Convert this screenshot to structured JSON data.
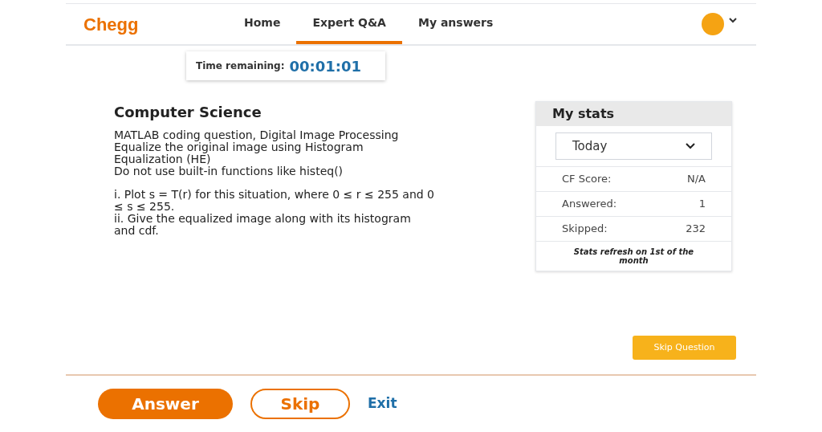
{
  "header": {
    "logo": "Chegg",
    "nav": [
      {
        "label": "Home",
        "selected": false
      },
      {
        "label": "Expert Q&A",
        "selected": true
      },
      {
        "label": "My answers",
        "selected": false
      }
    ]
  },
  "timer": {
    "label": "Time remaining:",
    "value": "00:01:01"
  },
  "question": {
    "subject": "Computer Science",
    "paragraphs": [
      [
        "MATLAB coding question, Digital Image Processing",
        "Equalize the original image using Histogram",
        "Equalization (HE)",
        "Do not use built-in functions like histeq()"
      ],
      [
        "i. Plot s = T(r) for this situation, where 0 ≤ r ≤ 255 and 0",
        "≤ s ≤ 255.",
        "ii. Give the equalized image along with its histogram",
        "and cdf."
      ]
    ]
  },
  "stats": {
    "title": "My stats",
    "period": "Today",
    "rows": [
      {
        "label": "CF Score:",
        "value": "N/A"
      },
      {
        "label": "Answered:",
        "value": "1"
      },
      {
        "label": "Skipped:",
        "value": "232"
      }
    ],
    "note": "Stats refresh on 1st of the month"
  },
  "skip_question": "Skip Question",
  "footer": {
    "answer": "Answer",
    "skip": "Skip",
    "exit": "Exit"
  }
}
